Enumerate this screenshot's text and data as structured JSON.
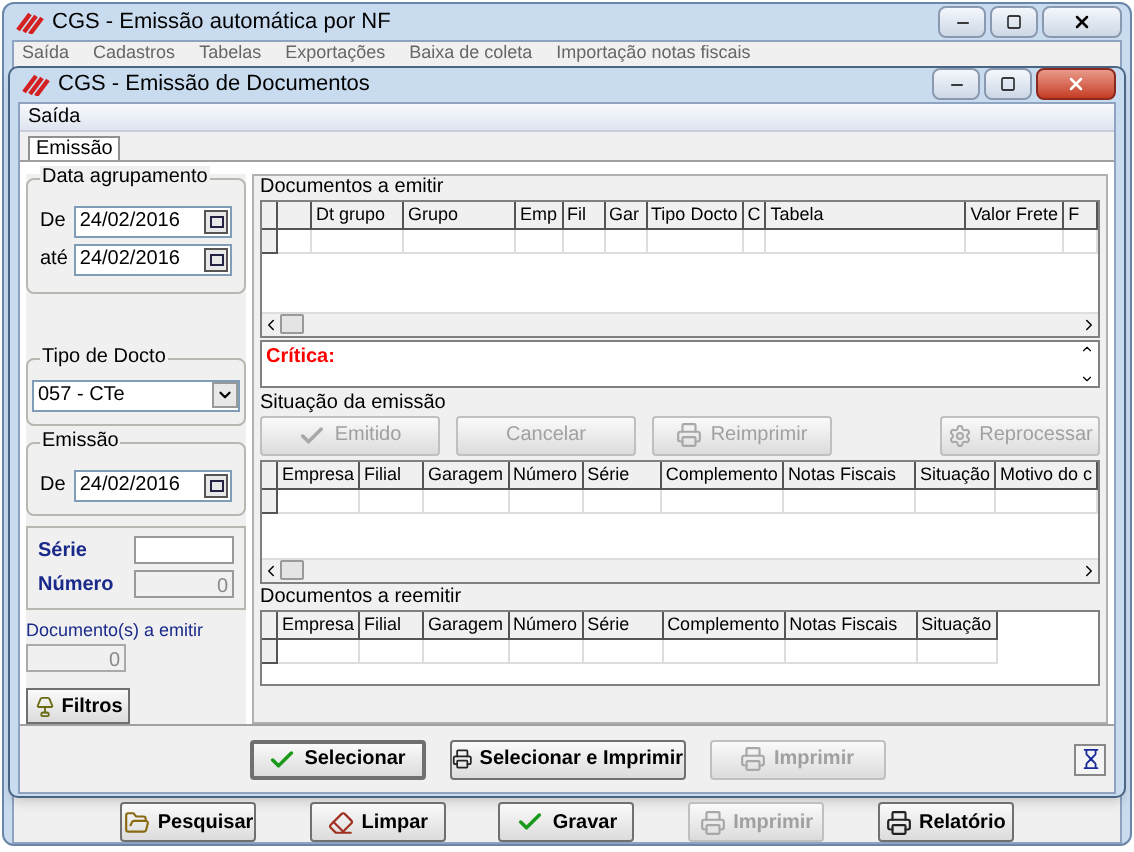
{
  "main_window": {
    "title": "CGS - Emissão automática por NF",
    "menu": [
      "Saída",
      "Cadastros",
      "Tabelas",
      "Exportações",
      "Baixa de coleta",
      "Importação notas fiscais"
    ],
    "buttons": [
      {
        "label": "Pesquisar",
        "disabled": false,
        "kind": "search"
      },
      {
        "label": "Limpar",
        "disabled": false,
        "kind": "clear"
      },
      {
        "label": "Gravar",
        "disabled": false,
        "kind": "save"
      },
      {
        "label": "Imprimir",
        "disabled": true,
        "kind": "print"
      },
      {
        "label": "Relatório",
        "disabled": false,
        "kind": "print"
      }
    ]
  },
  "dialog": {
    "title": "CGS - Emissão de Documentos",
    "menu": [
      "Saída"
    ],
    "tabs": [
      {
        "label": "Emissão",
        "selected": true
      }
    ],
    "date_group": {
      "title": "Data agrupamento",
      "from_label": "De",
      "from_value": "24/02/2016",
      "to_label": "até",
      "to_value": "24/02/2016"
    },
    "doc_type": {
      "title": "Tipo de Docto",
      "value": "057 - CTe"
    },
    "emission": {
      "title": "Emissão",
      "from_label": "De",
      "from_value": "24/02/2016"
    },
    "serie_label": "Série",
    "numero_label": "Número",
    "numero_value": "0",
    "docs_count": {
      "label": "Documento(s) a emitir",
      "value": "0"
    },
    "filter_button": "Filtros",
    "docs_to_emit": {
      "title": "Documentos a emitir",
      "columns": [
        "Dt grupo",
        "Grupo",
        "Emp",
        "Fil",
        "Gar",
        "Tipo Docto",
        "C",
        "Tabela",
        "Valor Frete",
        "F"
      ]
    },
    "critica_label": "Crítica:",
    "status": {
      "title": "Situação da emissão",
      "buttons": [
        {
          "label": "Emitido",
          "disabled": true,
          "kind": "check"
        },
        {
          "label": "Cancelar",
          "disabled": true,
          "kind": "plain"
        },
        {
          "label": "Reimprimir",
          "disabled": true,
          "kind": "print"
        },
        {
          "label": "Reprocessar",
          "disabled": true,
          "kind": "gear"
        }
      ],
      "columns": [
        "Empresa",
        "Filial",
        "Garagem",
        "Número",
        "Série",
        "Complemento",
        "Notas Fiscais",
        "Situação",
        "Motivo do c"
      ]
    },
    "reissue": {
      "title": "Documentos a reemitir",
      "columns": [
        "Empresa",
        "Filial",
        "Garagem",
        "Número",
        "Série",
        "Complemento",
        "Notas Fiscais",
        "Situação"
      ]
    },
    "actions": [
      {
        "label": "Selecionar",
        "disabled": false,
        "kind": "check"
      },
      {
        "label": "Selecionar e Imprimir",
        "disabled": false,
        "kind": "print"
      },
      {
        "label": "Imprimir",
        "disabled": true,
        "kind": "print"
      }
    ]
  }
}
